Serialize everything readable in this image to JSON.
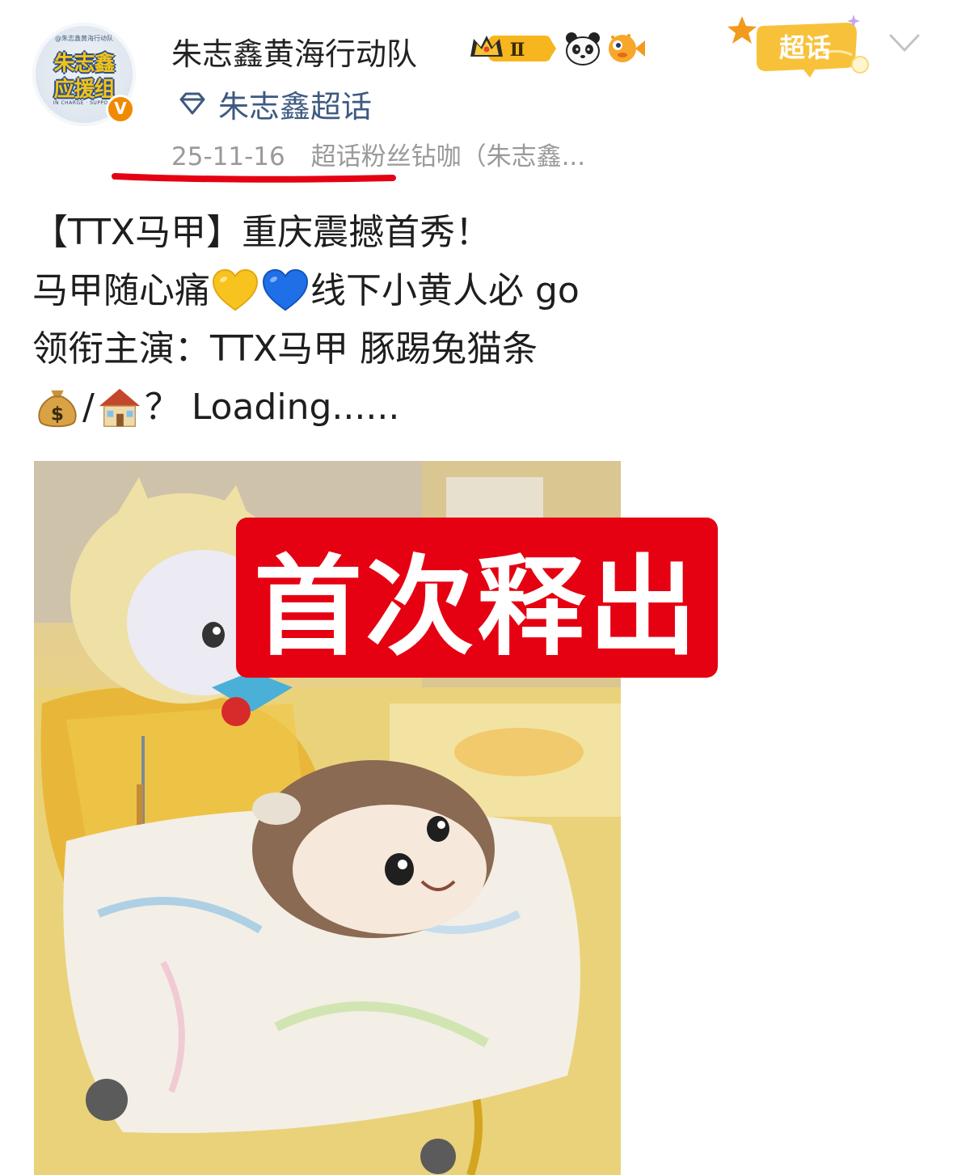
{
  "post": {
    "author": {
      "name": "朱志鑫黄海行动队",
      "avatar": {
        "top_text": "@朱志鑫黄海行动队",
        "line1": "朱志鑫",
        "line2": "应援组",
        "bottom_text": "IN CHARGE · SUPPORT"
      },
      "verified_mark": "V",
      "level_badge": "Ⅱ",
      "badge_icons": [
        "crown-badge-icon",
        "panda-icon",
        "pufferfish-icon"
      ]
    },
    "topic": {
      "label": "朱志鑫超话",
      "icon": "diamond-icon"
    },
    "meta": {
      "date": "25-11-16",
      "source": "超话粉丝钻咖（朱志鑫..."
    },
    "chaohua_tag": {
      "label": "超话",
      "icon": "star-icon"
    },
    "expand_icon": "chevron-down-icon",
    "content": {
      "line1": "【TTX马甲】重庆震撼首秀！",
      "line2_a": "马甲随心痛",
      "line2_b": "线下小黄人必 go",
      "line3": "领衔主演：TTX马甲 豚踢兔猫条",
      "line4_sep": "/",
      "line4_tail": "？ Loading......",
      "emojis": [
        "yellow-heart-icon",
        "blue-heart-icon",
        "money-bag-icon",
        "house-icon"
      ]
    },
    "image": {
      "overlay_label": "首次释出"
    }
  },
  "colors": {
    "topic_link": "#3d5a80",
    "meta_text": "#9a9a9a",
    "underline": "#e50012",
    "stamp_bg": "#e50012",
    "verified": "#f08a00",
    "chaohua_tag": "#f7c23a"
  }
}
